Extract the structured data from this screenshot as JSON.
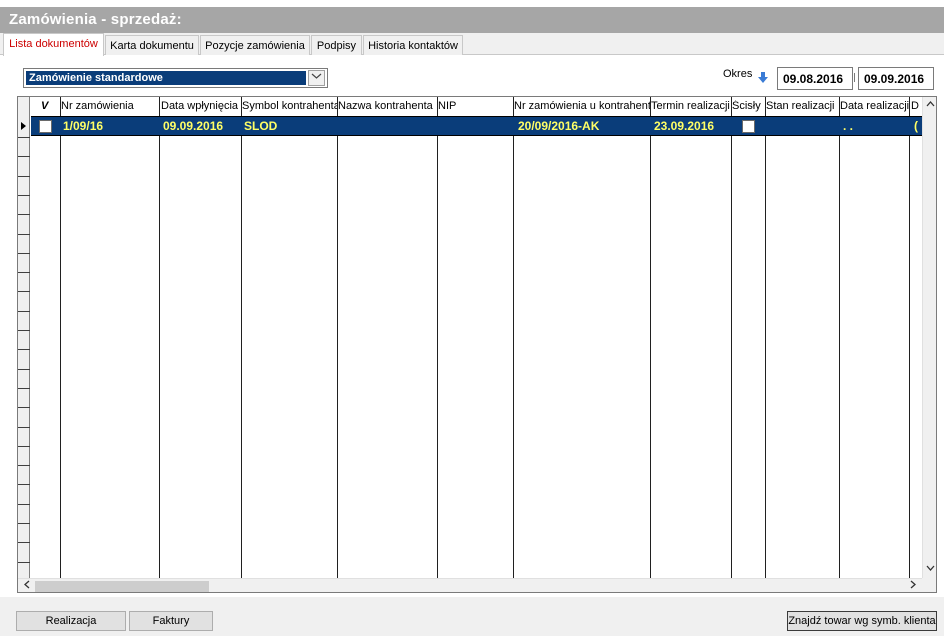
{
  "window": {
    "title": "Zamówienia - sprzedaż:"
  },
  "tabs": [
    {
      "label": "Lista dokumentów",
      "active": true
    },
    {
      "label": "Karta dokumentu",
      "active": false
    },
    {
      "label": "Pozycje zamówienia",
      "active": false
    },
    {
      "label": "Podpisy",
      "active": false
    },
    {
      "label": "Historia kontaktów",
      "active": false
    }
  ],
  "filter": {
    "document_type": "Zamówienie standardowe",
    "chevron_icon": "chevron-down-icon"
  },
  "period": {
    "label": "Okres",
    "arrow_icon": "arrow-down-icon",
    "from": "09.08.2016",
    "to": "09.09.2016"
  },
  "grid": {
    "headers": [
      "V",
      "Nr zamówienia",
      "Data wpłynięcia",
      "Symbol kontrahenta",
      "Nazwa kontrahenta",
      "NIP",
      "Nr zamówienia u kontrahenta",
      "Termin realizacji",
      "Ścisły",
      "Stan realizacji",
      "Data realizacji",
      "D"
    ],
    "rows": [
      {
        "checked": false,
        "nr_zamowienia": "1/09/16",
        "data_wplyniecia": "09.09.2016",
        "symbol_kontrahenta": "SLOD",
        "nazwa_kontrahenta": "",
        "nip": "",
        "nr_zamowienia_u_kontrahenta": "20/09/2016-AK",
        "termin_realizacji": "23.09.2016",
        "scisly": false,
        "stan_realizacji": "",
        "data_realizacji": ". .",
        "d": "("
      }
    ],
    "selection_color": "#0a3d7a",
    "selected_text_color": "#ffff66"
  },
  "buttons": {
    "realizacja": "Realizacja",
    "faktury": "Faktury",
    "znajdz_towar": "Znajdź towar wg symb. klienta"
  }
}
